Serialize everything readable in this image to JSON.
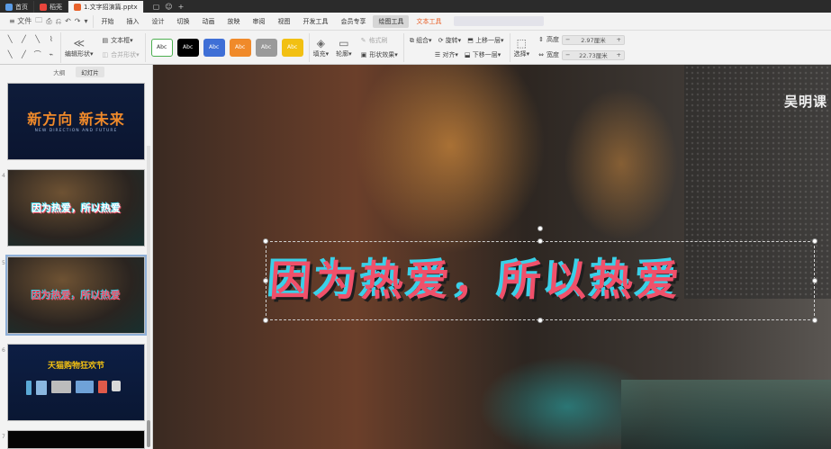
{
  "tabs": [
    {
      "label": "首页",
      "color": "#5a9be6",
      "active": false
    },
    {
      "label": "稻壳",
      "color": "#e8453c",
      "active": false
    },
    {
      "label": "1.文字招演篇.pptx",
      "color": "#e8612a",
      "active": true
    }
  ],
  "tab_tools": [
    "▢",
    "☺",
    "+"
  ],
  "quick_access": {
    "file_label": "≡ 文件",
    "icons": [
      "🗀",
      "⎙",
      "⎌",
      "↶",
      "↷",
      "▾"
    ]
  },
  "menu": [
    {
      "label": "开始"
    },
    {
      "label": "插入"
    },
    {
      "label": "设计"
    },
    {
      "label": "切换"
    },
    {
      "label": "动画"
    },
    {
      "label": "放映"
    },
    {
      "label": "审阅"
    },
    {
      "label": "视图"
    },
    {
      "label": "开发工具"
    },
    {
      "label": "会员专享"
    },
    {
      "label": "绘图工具",
      "state": "tool-active"
    },
    {
      "label": "文本工具",
      "state": "accent"
    }
  ],
  "ribbon": {
    "shape_glyphs": [
      "╲",
      "╱",
      "╲",
      "⌇",
      "╲",
      "╱",
      "⌒",
      "⌁"
    ],
    "edit_shape": {
      "icon": "≪",
      "label": "编辑形状▾"
    },
    "text_box": "文本框▾",
    "merge_shapes": "合并形状▾",
    "style_labels": [
      "Abc",
      "Abc",
      "Abc",
      "Abc",
      "Abc",
      "Abc"
    ],
    "style_colors": [
      {
        "bg": "#ffffff",
        "fg": "#333333",
        "border": "#4caf50"
      },
      {
        "bg": "#000000",
        "fg": "#ffffff",
        "border": "#000000"
      },
      {
        "bg": "#3f6fd6",
        "fg": "#ffffff",
        "border": "#3f6fd6"
      },
      {
        "bg": "#f08a2a",
        "fg": "#ffffff",
        "border": "#f08a2a"
      },
      {
        "bg": "#9a9a9a",
        "fg": "#ffffff",
        "border": "#9a9a9a"
      },
      {
        "bg": "#f2c012",
        "fg": "#ffffff",
        "border": "#f2c012"
      }
    ],
    "fill": "填充▾",
    "outline": "轮廓▾",
    "format_painter": "格式刷",
    "shape_effects": "形状效果▾",
    "combine": "组合▾",
    "rotate": "旋转▾",
    "align": "对齐▾",
    "bring_forward": "上移一层▾",
    "send_backward": "下移一层▾",
    "select": "选择▾",
    "height_label": "高度",
    "height_value": "2.97厘米",
    "width_label": "宽度",
    "width_value": "22.73厘米"
  },
  "left_panel": {
    "tabs": [
      "大纲",
      "幻灯片"
    ],
    "slides": [
      {
        "num": "",
        "title": "新方向 新未来",
        "subtitle": "NEW DIRECTION AND FUTURE",
        "theme": "dark-blue"
      },
      {
        "num": "4",
        "title": "因为热爱，所以热爱",
        "theme": "photo-white"
      },
      {
        "num": "5",
        "title": "因为热爱，所以热爱",
        "theme": "photo-red",
        "selected": true
      },
      {
        "num": "6",
        "title": "天猫购物狂欢节",
        "theme": "navy-products"
      },
      {
        "num": "7",
        "title": "",
        "theme": "black"
      }
    ]
  },
  "canvas": {
    "headline": "因为热爱，所以热爱",
    "watermark": "吴明课"
  }
}
